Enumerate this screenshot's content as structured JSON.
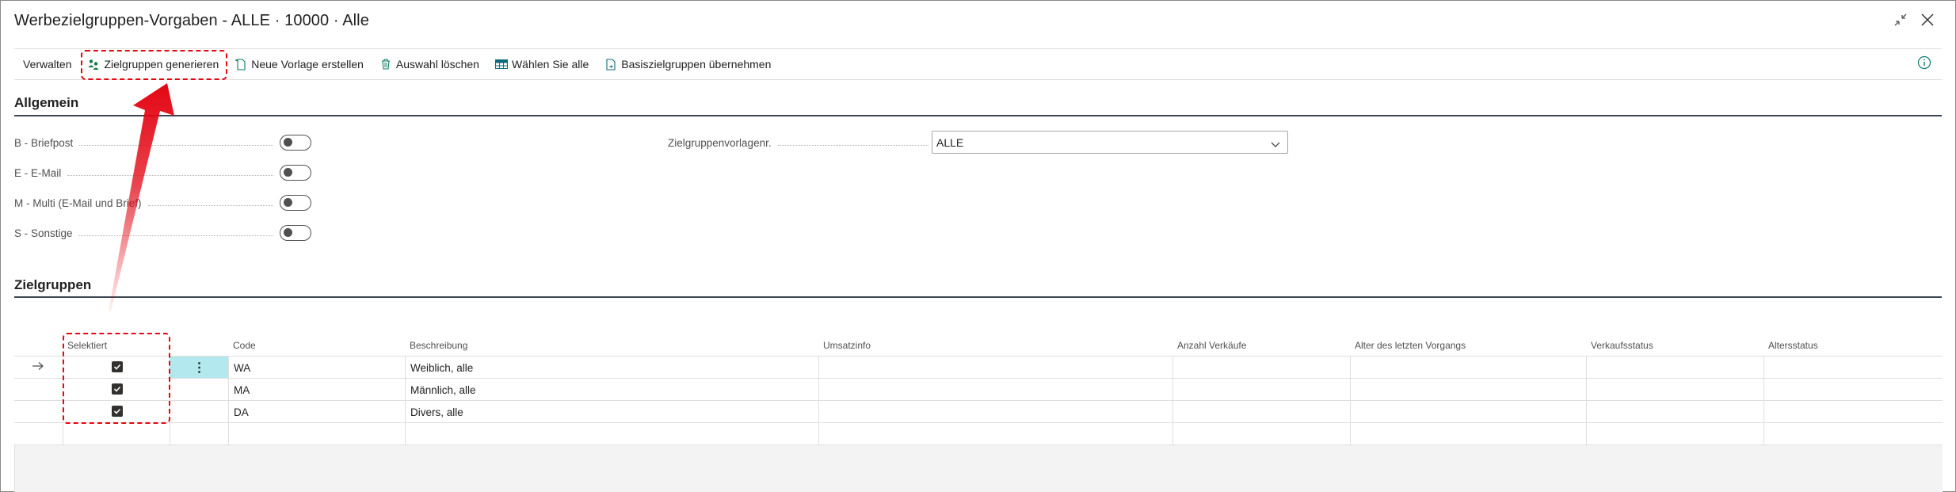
{
  "window": {
    "title": "Werbezielgruppen-Vorgaben - ALLE · 10000 · Alle",
    "collapse_icon": "collapse-arrows-icon",
    "close_icon": "close-icon"
  },
  "actions": [
    {
      "label": "Verwalten",
      "icon": ""
    },
    {
      "label": "Zielgruppen generieren",
      "icon": "people-group-icon"
    },
    {
      "label": "Neue Vorlage erstellen",
      "icon": "new-template-icon"
    },
    {
      "label": "Auswahl löschen",
      "icon": "trash-icon"
    },
    {
      "label": "Wählen Sie alle",
      "icon": "select-all-grid-icon"
    },
    {
      "label": "Basiszielgruppen übernehmen",
      "icon": "document-arrow-icon"
    }
  ],
  "info_icon": "info-icon",
  "general": {
    "heading": "Allgemein",
    "toggles": [
      {
        "label": "B - Briefpost",
        "on": false
      },
      {
        "label": "E - E-Mail",
        "on": false
      },
      {
        "label": "M - Multi (E-Mail und Brief)",
        "on": false
      },
      {
        "label": "S - Sonstige",
        "on": false
      }
    ],
    "template_field": {
      "label": "Zielgruppenvorlagenr.",
      "value": "ALLE"
    }
  },
  "target_groups": {
    "heading": "Zielgruppen",
    "columns": [
      "Selektiert",
      "",
      "Code",
      "Beschreibung",
      "Umsatzinfo",
      "Anzahl Verkäufe",
      "Alter des letzten Vorgangs",
      "Verkaufsstatus",
      "Altersstatus"
    ],
    "rows": [
      {
        "selected": true,
        "code": "WA",
        "description": "Weiblich, alle",
        "current": true
      },
      {
        "selected": true,
        "code": "MA",
        "description": "Männlich, alle",
        "current": false
      },
      {
        "selected": true,
        "code": "DA",
        "description": "Divers, alle",
        "current": false
      }
    ]
  },
  "colors": {
    "accent": "#00b7c3",
    "annotation": "#e30613",
    "row_highlight": "#b3e8ee",
    "section_rule": "#3b4752"
  }
}
